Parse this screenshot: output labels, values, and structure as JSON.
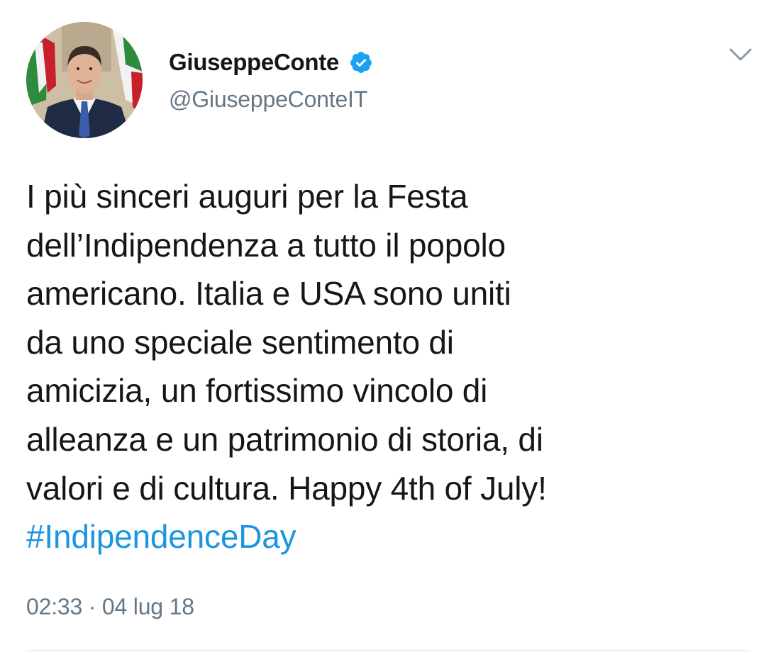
{
  "user": {
    "display_name": "GiuseppeConte",
    "handle": "@GiuseppeConteIT",
    "verified": true,
    "avatar_icon": "profile-photo"
  },
  "tweet": {
    "lines": [
      "I più sinceri auguri per la Festa",
      "dell’Indipendenza a tutto il popolo",
      "americano. Italia e USA sono uniti",
      "da uno speciale sentimento di",
      "amicizia, un fortissimo vincolo di",
      "alleanza e un patrimonio di storia, di",
      "valori e di cultura. Happy 4th of July!"
    ],
    "hashtag": "#IndipendenceDay",
    "timestamp": "02:33 · 04 lug 18"
  },
  "icons": {
    "verified": "verified-badge-icon",
    "menu": "chevron-down-icon"
  },
  "colors": {
    "text": "#14171a",
    "secondary": "#657786",
    "link": "#1b95e0",
    "verified": "#1da1f2"
  }
}
